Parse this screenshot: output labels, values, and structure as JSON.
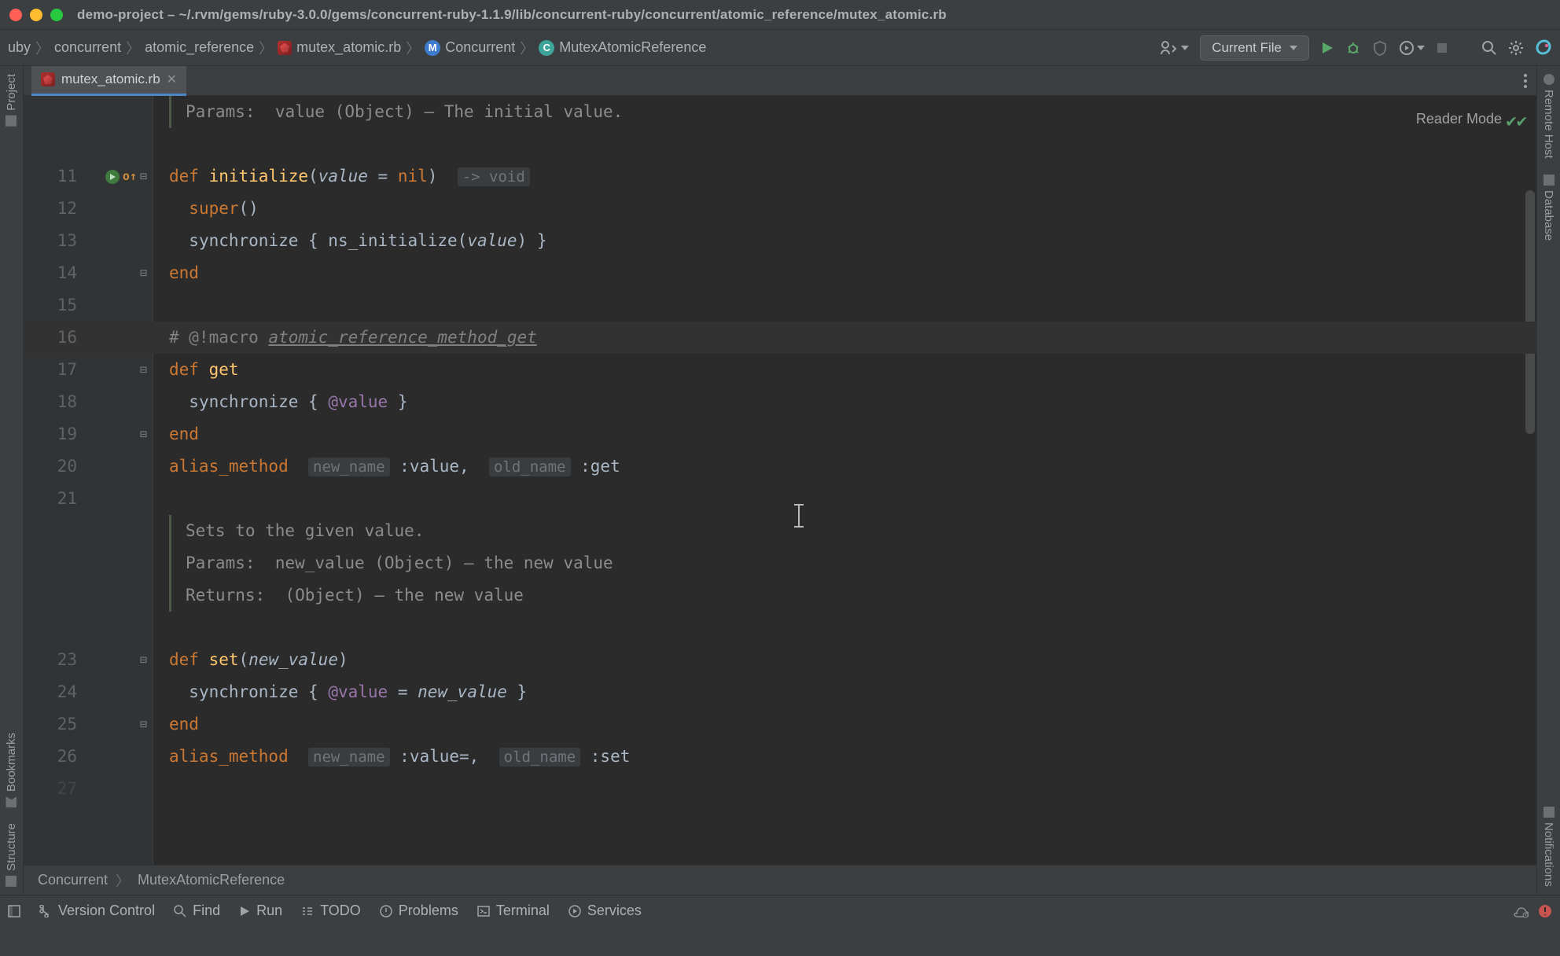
{
  "window": {
    "title": "demo-project – ~/.rvm/gems/ruby-3.0.0/gems/concurrent-ruby-1.1.9/lib/concurrent-ruby/concurrent/atomic_reference/mutex_atomic.rb"
  },
  "breadcrumbs": {
    "items": [
      {
        "label": "uby"
      },
      {
        "label": "concurrent"
      },
      {
        "label": "atomic_reference"
      },
      {
        "label": "mutex_atomic.rb",
        "icon": "ruby"
      },
      {
        "label": "Concurrent",
        "badge": "M",
        "badgeClass": "bg-blue"
      },
      {
        "label": "MutexAtomicReference",
        "badge": "C",
        "badgeClass": "bg-teal"
      }
    ]
  },
  "run_config": "Current File",
  "tab": {
    "filename": "mutex_atomic.rb"
  },
  "reader_mode": "Reader Mode",
  "left_rail": [
    "Project",
    "Bookmarks",
    "Structure"
  ],
  "right_rail": [
    "Remote Host",
    "Database",
    "Notifications"
  ],
  "code": {
    "doc1_l1": "Params:",
    "doc1_l1b": "value (Object) — The initial value.",
    "l11_def": "def",
    "l11_fn": "initialize",
    "l11_open": "(",
    "l11_p": "value",
    "l11_eq": " = ",
    "l11_nil": "nil",
    "l11_close": ") ",
    "l11_hint": "-> void",
    "l12": "super()",
    "l13a": "synchronize { ns_initialize(",
    "l13p": "value",
    "l13b": ") }",
    "l14": "end",
    "l16a": "# @!macro ",
    "l16b": "atomic_reference_method_get",
    "l17a": "def ",
    "l17b": "get",
    "l18a": "synchronize { ",
    "l18b": "@value",
    "l18c": " }",
    "l19": "end",
    "l20a": "alias_method",
    "l20h1": "new_name",
    "l20b": " :value,",
    "l20h2": "old_name",
    "l20c": " :get",
    "doc2_l1": "Sets to the given value.",
    "doc2_l2a": "Params:",
    "doc2_l2b": "new_value (Object) — the new value",
    "doc2_l3a": "Returns:",
    "doc2_l3b": "(Object) — the new value",
    "l23a": "def ",
    "l23b": "set",
    "l23c": "(",
    "l23p": "new_value",
    "l23d": ")",
    "l24a": "synchronize { ",
    "l24b": "@value",
    "l24c": " = ",
    "l24p": "new_value",
    "l24d": " }",
    "l25": "end",
    "l26a": "alias_method",
    "l26h1": "new_name",
    "l26b": " :value=,",
    "l26h2": "old_name",
    "l26c": " :set",
    "line_numbers": [
      "",
      "11",
      "12",
      "13",
      "14",
      "15",
      "16",
      "17",
      "18",
      "19",
      "20",
      "21",
      "",
      "",
      "",
      "23",
      "24",
      "25",
      "26",
      "27"
    ]
  },
  "foot_crumbs": [
    "Concurrent",
    "MutexAtomicReference"
  ],
  "statusbar": {
    "vcs": "Version Control",
    "find": "Find",
    "run": "Run",
    "todo": "TODO",
    "problems": "Problems",
    "terminal": "Terminal",
    "services": "Services"
  }
}
